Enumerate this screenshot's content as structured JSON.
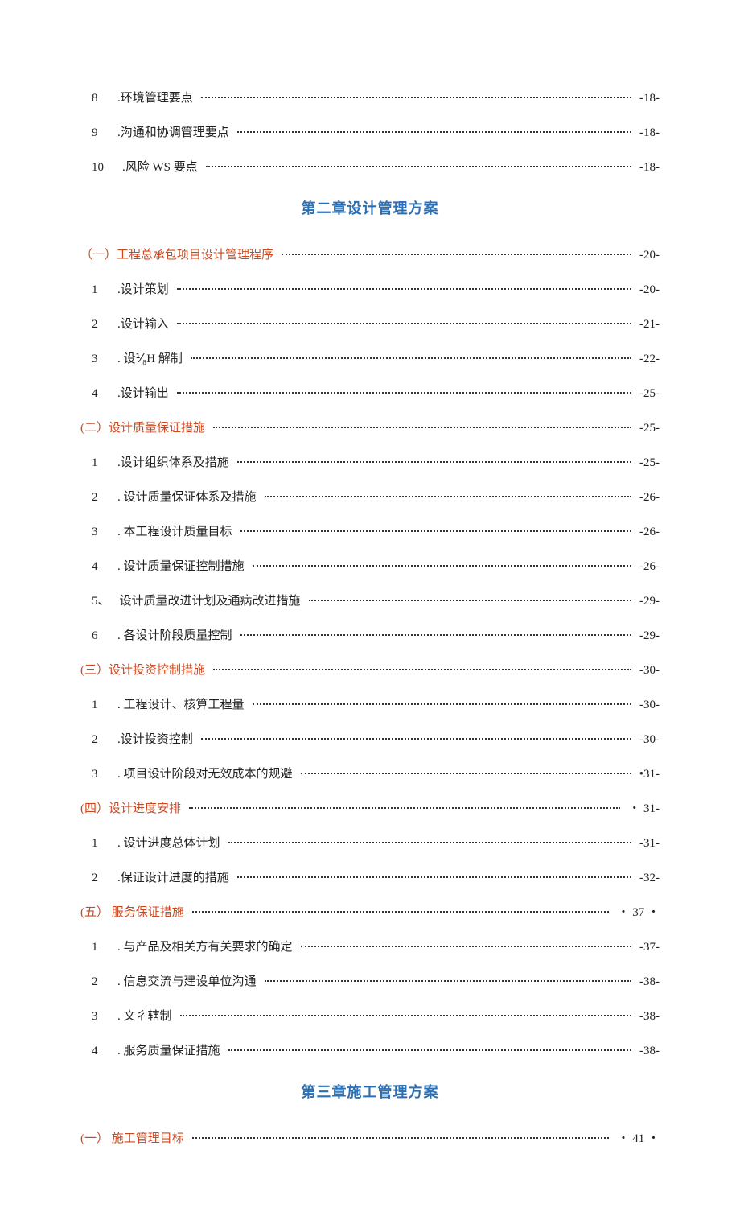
{
  "top": [
    {
      "num": "8",
      "label": ".环境管理要点",
      "page": "-18-"
    },
    {
      "num": "9",
      "label": ".沟通和协调管理要点",
      "page": "-18-"
    },
    {
      "num": "10",
      "label": ".风险 WS 要点",
      "page": "-18-"
    }
  ],
  "chapter2": {
    "title": "第二章设计管理方案",
    "sections": [
      {
        "level": 1,
        "label": "（一）工程总承包项目设计管理程序",
        "page": "-20-"
      },
      {
        "level": 2,
        "num": "1",
        "label": ".设计策划",
        "page": "-20-"
      },
      {
        "level": 2,
        "num": "2",
        "label": ".设计输入",
        "page": "-21-"
      },
      {
        "level": 2,
        "num": "3",
        "label": ". 设⅟₈H 解制",
        "page": "-22-"
      },
      {
        "level": 2,
        "num": "4",
        "label": ".设计输出",
        "page": "-25-"
      },
      {
        "level": 1,
        "label": "(二）设计质量保证措施",
        "page": "-25-"
      },
      {
        "level": 2,
        "num": "1",
        "label": ".设计组织体系及措施",
        "page": "-25-"
      },
      {
        "level": 2,
        "num": "2",
        "label": ". 设计质量保证体系及措施",
        "page": "-26-"
      },
      {
        "level": 2,
        "num": "3",
        "label": ". 本工程设计质量目标",
        "page": "-26-"
      },
      {
        "level": 2,
        "num": "4",
        "label": ". 设计质量保证控制措施",
        "page": "-26-"
      },
      {
        "level": 2,
        "num": "5、",
        "label": "设计质量改进计划及通病改进措施",
        "page": "-29-"
      },
      {
        "level": 2,
        "num": "6",
        "label": ". 各设计阶段质量控制",
        "page": "-29-"
      },
      {
        "level": 1,
        "label": "(三）设计投资控制措施",
        "page": "-30-"
      },
      {
        "level": 2,
        "num": "1",
        "label": ". 工程设计、核算工程量",
        "page": "-30-"
      },
      {
        "level": 2,
        "num": "2",
        "label": ".设计投资控制",
        "page": "-30-"
      },
      {
        "level": 2,
        "num": "3",
        "label": ". 项目设计阶段对无效成本的规避",
        "page": "•31-"
      },
      {
        "level": 1,
        "label": "(四）设计进度安排",
        "page": "・ 31-"
      },
      {
        "level": 2,
        "num": "1",
        "label": ". 设计进度总体计划",
        "page": "-31-"
      },
      {
        "level": 2,
        "num": "2",
        "label": ".保证设计进度的措施",
        "page": "-32-"
      },
      {
        "level": 1,
        "label": "(五） 服务保证措施",
        "page": "・ 37 ・"
      },
      {
        "level": 2,
        "num": "1",
        "label": ". 与产品及相关方有关要求的确定",
        "page": "-37-"
      },
      {
        "level": 2,
        "num": "2",
        "label": ". 信息交流与建设单位沟通",
        "page": "-38-"
      },
      {
        "level": 2,
        "num": "3",
        "label": ". 文彳辖制",
        "page": "-38-"
      },
      {
        "level": 2,
        "num": "4",
        "label": ". 服务质量保证措施",
        "page": "-38-"
      }
    ]
  },
  "chapter3": {
    "title": "第三章施工管理方案",
    "sections": [
      {
        "level": 1,
        "label": "(一） 施工管理目标",
        "page": "・ 41 ・"
      }
    ]
  }
}
